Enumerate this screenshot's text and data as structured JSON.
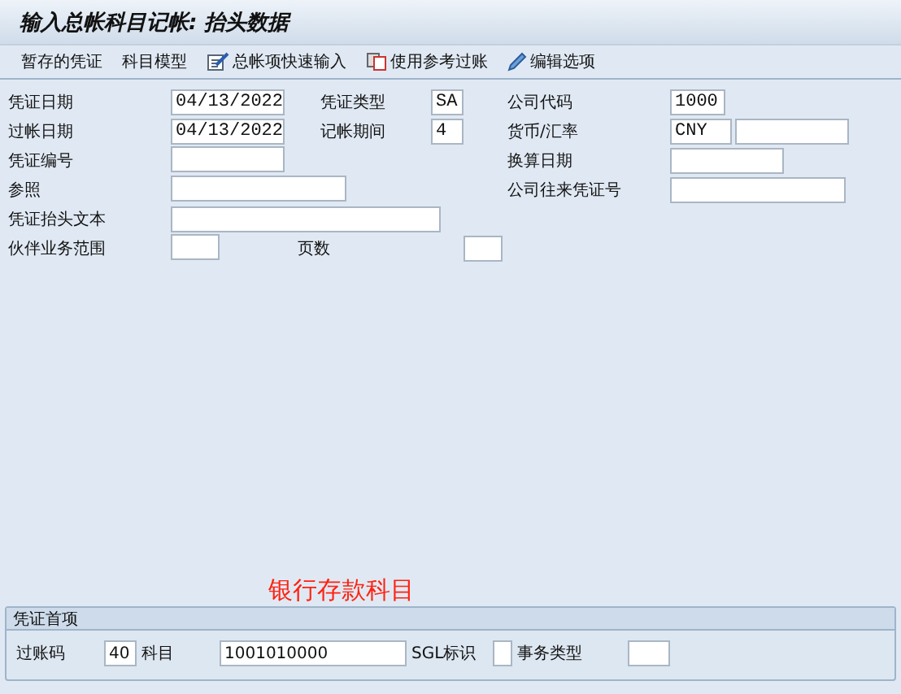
{
  "window": {
    "title": "输入总帐科目记帐: 抬头数据"
  },
  "toolbar": [
    {
      "label": "暂存的凭证",
      "kind": "text"
    },
    {
      "label": "科目模型",
      "kind": "text"
    },
    {
      "label": "总帐项快速输入",
      "kind": "quick-entry"
    },
    {
      "label": "使用参考过账",
      "kind": "copy"
    },
    {
      "label": "编辑选项",
      "kind": "pencil"
    }
  ],
  "header": {
    "document_date": {
      "label": "凭证日期",
      "value": "04/13/2022"
    },
    "document_type": {
      "label": "凭证类型",
      "value": "SA"
    },
    "company_code": {
      "label": "公司代码",
      "value": "1000"
    },
    "posting_date": {
      "label": "过帐日期",
      "value": "04/13/2022"
    },
    "period": {
      "label": "记帐期间",
      "value": "4"
    },
    "currency": {
      "label": "货币/汇率",
      "value": "CNY"
    },
    "document_number": {
      "label": "凭证编号"
    },
    "translation_date": {
      "label": "换算日期"
    },
    "reference": {
      "label": "参照"
    },
    "intercompany_number": {
      "label": "公司往来凭证号"
    },
    "header_text": {
      "label": "凭证抬头文本"
    },
    "partner_area": {
      "label": "伙伴业务范围"
    },
    "pages": {
      "label": "页数"
    }
  },
  "annotation": "银行存款科目",
  "first_item": {
    "title": "凭证首项",
    "posting_key": {
      "label": "过账码",
      "value": "40"
    },
    "account": {
      "label": "科目",
      "value": "1001010000"
    },
    "sgl": {
      "label": "SGL标识"
    },
    "transaction_type": {
      "label": "事务类型"
    }
  }
}
